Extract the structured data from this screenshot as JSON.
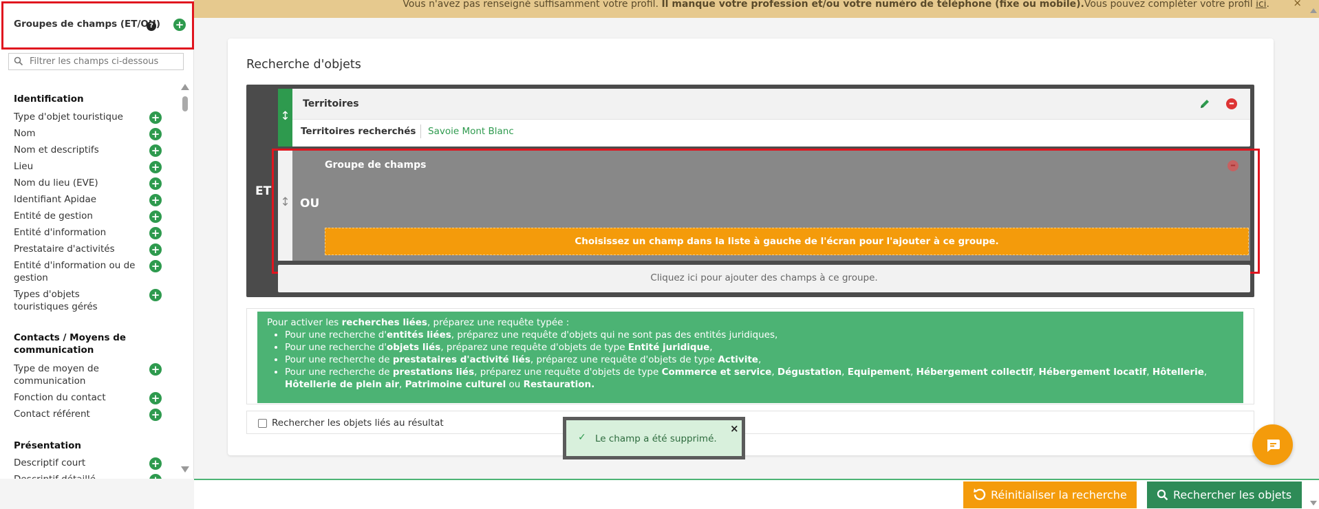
{
  "banner": {
    "text_normal": "Vous n'avez pas renseigné suffisamment votre profil. ",
    "text_bold": "Il manque votre profession et/ou votre numéro de téléphone (fixe ou mobile).",
    "text_end": "Vous pouvez compléter votre profil ",
    "link": "ici",
    "period": ".",
    "close": "×"
  },
  "sidebar": {
    "groups_title": "Groupes de champs (ET/OU)",
    "help": "?",
    "add": "+",
    "filter_placeholder": "Filtrer les champs ci-dessous",
    "sections": [
      {
        "title": "Identification"
      },
      {
        "title": "Contacts / Moyens de communication"
      },
      {
        "title": "Présentation"
      }
    ],
    "items": [
      "Type d'objet touristique",
      "Nom",
      "Nom et descriptifs",
      "Lieu",
      "Nom du lieu (EVE)",
      "Identifiant Apidae",
      "Entité de gestion",
      "Entité d'information",
      "Prestataire d'activités",
      "Entité d'information ou de gestion",
      "Types d'objets touristiques gérés",
      "Type de moyen de communication",
      "Fonction du contact",
      "Contact référent",
      "Descriptif court",
      "Descriptif détaillé"
    ],
    "plus": "+"
  },
  "main": {
    "title": "Recherche d'objets",
    "et_label": "ET",
    "territoires": {
      "title": "Territoires",
      "row_label": "Territoires recherchés",
      "row_value": "Savoie Mont Blanc"
    },
    "group": {
      "title": "Groupe de champs",
      "ou_label": "OU",
      "hint": "Choisissez un champ dans la liste à gauche de l'écran pour l'ajouter à ce groupe."
    },
    "add_fields": "Cliquez ici pour ajouter des champs à ce groupe.",
    "info": {
      "intro_1": "Pour activer les ",
      "intro_b": "recherches liées",
      "intro_2": ", préparez une requête typée :",
      "b1_a": "Pour une recherche d'",
      "b1_b": "entités liées",
      "b1_c": ", préparez une requête d'objets qui ne sont pas des entités juridiques,",
      "b2_a": "Pour une recherche d'",
      "b2_b": "objets liés",
      "b2_c": ", préparez une requête d'objets de type ",
      "b2_d": "Entité juridique",
      "b2_e": ",",
      "b3_a": "Pour une recherche de ",
      "b3_b": "prestataires d'activité liés",
      "b3_c": ", préparez une requête d'objets de type ",
      "b3_d": "Activite",
      "b3_e": ",",
      "b4_a": "Pour une recherche de ",
      "b4_b": "prestations liés",
      "b4_c": ", préparez une requête d'objets de type ",
      "b4_d": "Commerce et service",
      "b4_s1": ", ",
      "b4_e": "Dégustation",
      "b4_s2": ", ",
      "b4_f": "Equipement",
      "b4_s3": ", ",
      "b4_g": "Hébergement collectif",
      "b4_s4": ", ",
      "b4_h": "Hébergement locatif",
      "b4_s5": ", ",
      "b4_i": "Hôtellerie",
      "b4_s6": ", ",
      "b4_j": "Hôtellerie de plein air",
      "b4_s7": ", ",
      "b4_k": "Patrimoine culturel",
      "b4_s8": " ou ",
      "b4_l": "Restauration.",
      "b4_s9": ""
    },
    "linked_checkbox_label": "Rechercher les objets liés au résultat"
  },
  "toast": {
    "message": "Le champ a été supprimé.",
    "close": "×"
  },
  "footer": {
    "reset_label": "Réinitialiser la recherche",
    "search_label": "Rechercher les objets"
  },
  "colors": {
    "accent_green": "#2e9a4e",
    "accent_orange": "#f49b0b",
    "highlight_red": "#e0141e",
    "banner": "#e6c98e"
  }
}
